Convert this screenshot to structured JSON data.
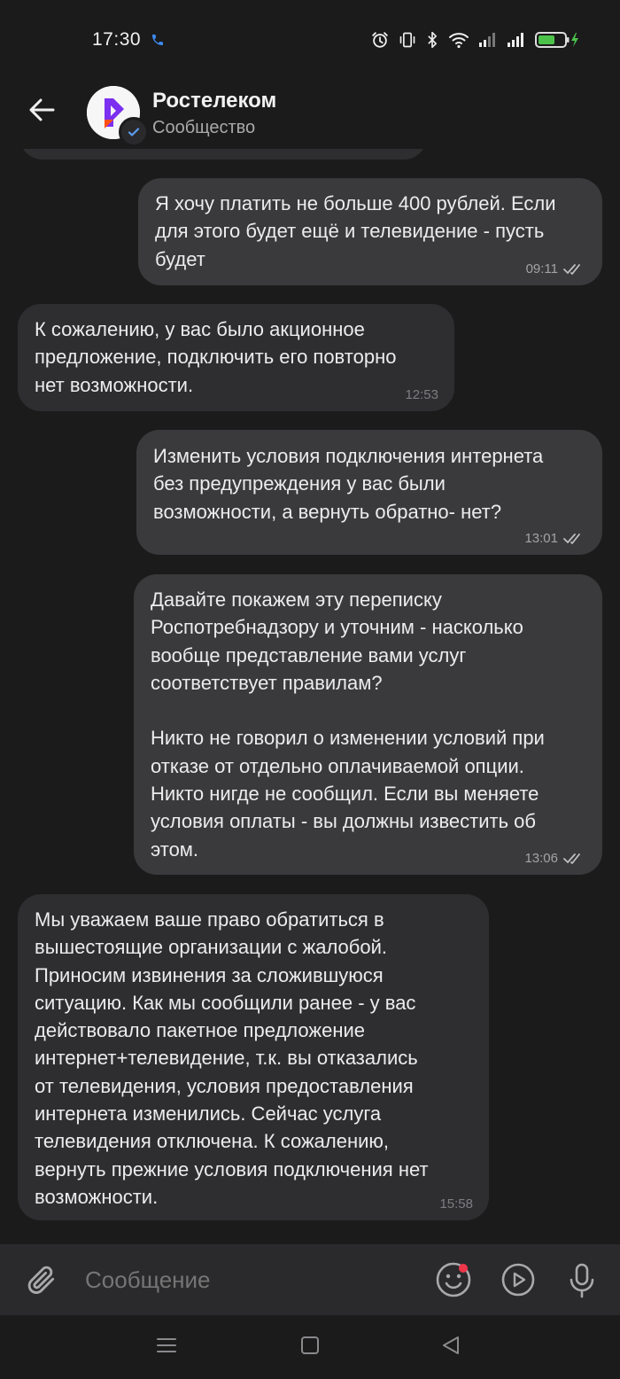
{
  "status_bar": {
    "time": "17:30"
  },
  "header": {
    "title": "Ростелеком",
    "subtitle": "Сообщество"
  },
  "messages": [
    {
      "dir": "out",
      "text": "Я хочу платить не больше 400 рублей. Если\nдля этого будет ещё и телевидение - пусть\nбудет",
      "time": "09:11"
    },
    {
      "dir": "in",
      "text": "К сожалению, у вас было акционное\nпредложение, подключить его повторно\nнет возможности.",
      "time": "12:53"
    },
    {
      "dir": "out",
      "text": "Изменить условия подключения интернета\nбез предупреждения у вас были\nвозможности, а вернуть обратно- нет?",
      "time": "13:01"
    },
    {
      "dir": "out",
      "text": "Давайте покажем эту переписку\nРоспотребнадзору и уточним - насколько\nвообще представление вами услуг\nсоответствует правилам?\n\nНикто не говорил о изменении условий при\nотказе от отдельно оплачиваемой опции.\nНикто нигде не сообщил. Если вы меняете\nусловия оплаты - вы должны известить об\nэтом.",
      "time": "13:06"
    },
    {
      "dir": "in",
      "text": "Мы уважаем ваше право обратиться в\nвышестоящие организации с жалобой.\nПриносим извинения за сложившуюся\nситуацию. Как мы сообщили ранее - у вас\nдействовало пакетное предложение\nинтернет+телевидение, т.к. вы отказались\nот телевидения, условия предоставления\nинтернета изменились. Сейчас услуга\nтелевидения отключена. К сожалению,\nвернуть прежние условия подключения нет\nвозможности.",
      "time": "15:58"
    }
  ],
  "composer": {
    "placeholder": "Сообщение"
  },
  "colors": {
    "background": "#1b1b1c",
    "outgoing_bubble": "#3a3a3c",
    "incoming_bubble": "#2e2e30",
    "battery": "#4cc24a"
  }
}
